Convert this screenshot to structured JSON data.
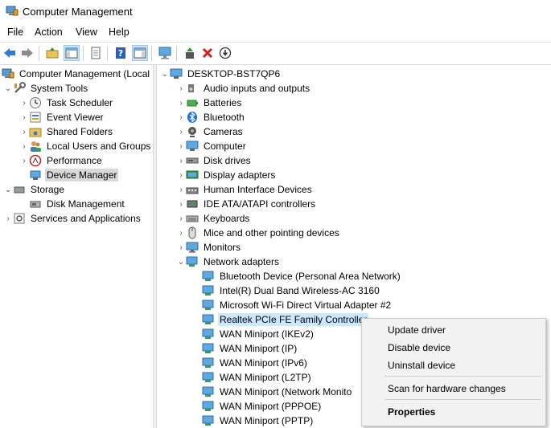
{
  "window": {
    "title": "Computer Management"
  },
  "menu": {
    "file": "File",
    "action": "Action",
    "view": "View",
    "help": "Help"
  },
  "tree": {
    "root": "Computer Management (Local",
    "system_tools": "System Tools",
    "task_scheduler": "Task Scheduler",
    "event_viewer": "Event Viewer",
    "shared_folders": "Shared Folders",
    "local_users": "Local Users and Groups",
    "performance": "Performance",
    "device_manager": "Device Manager",
    "storage": "Storage",
    "disk_management": "Disk Management",
    "services": "Services and Applications"
  },
  "devices": {
    "computer": "DESKTOP-BST7QP6",
    "categories": [
      "Audio inputs and outputs",
      "Batteries",
      "Bluetooth",
      "Cameras",
      "Computer",
      "Disk drives",
      "Display adapters",
      "Human Interface Devices",
      "IDE ATA/ATAPI controllers",
      "Keyboards",
      "Mice and other pointing devices",
      "Monitors",
      "Network adapters"
    ],
    "network_adapters": [
      "Bluetooth Device (Personal Area Network)",
      "Intel(R) Dual Band Wireless-AC 3160",
      "Microsoft Wi-Fi Direct Virtual Adapter #2",
      "Realtek PCIe FE Family Controller",
      "WAN Miniport (IKEv2)",
      "WAN Miniport (IP)",
      "WAN Miniport (IPv6)",
      "WAN Miniport (L2TP)",
      "WAN Miniport (Network Monito",
      "WAN Miniport (PPPOE)",
      "WAN Miniport (PPTP)"
    ]
  },
  "context_menu": {
    "update_driver": "Update driver",
    "disable_device": "Disable device",
    "uninstall_device": "Uninstall device",
    "scan": "Scan for hardware changes",
    "properties": "Properties"
  }
}
